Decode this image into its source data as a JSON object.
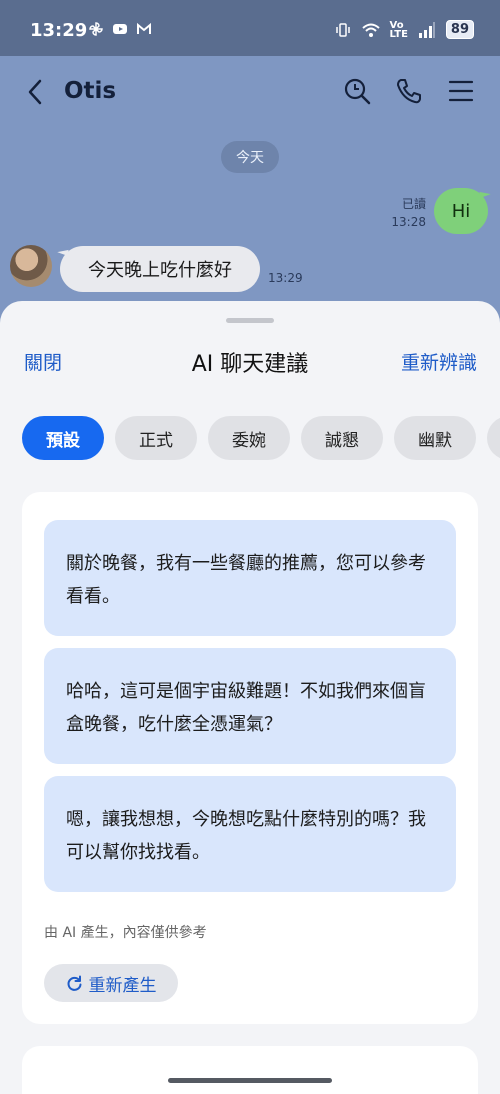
{
  "status_bar": {
    "time": "13:29",
    "volte_line1": "Vo",
    "volte_line2": "LTE",
    "battery": "89"
  },
  "chat": {
    "contact_name": "Otis",
    "date_divider": "今天",
    "my_message": {
      "text": "Hi",
      "read_label": "已讀",
      "time": "13:28"
    },
    "their_message": {
      "text": "今天晚上吃什麼好",
      "time": "13:29"
    }
  },
  "sheet": {
    "close_label": "關閉",
    "title": "AI 聊天建議",
    "reanalyze_label": "重新辨識",
    "tabs": [
      {
        "label": "預設",
        "active": true
      },
      {
        "label": "正式",
        "active": false
      },
      {
        "label": "委婉",
        "active": false
      },
      {
        "label": "誠懇",
        "active": false
      },
      {
        "label": "幽默",
        "active": false
      }
    ],
    "suggestions": [
      "關於晚餐，我有一些餐廳的推薦，您可以參考看看。",
      "哈哈，這可是個宇宙級難題！不如我們來個盲盒晚餐，吃什麼全憑運氣？",
      "嗯，讓我想想，今晚想吃點什麼特別的嗎？我可以幫你找找看。"
    ],
    "disclaimer": "由 AI 產生，內容僅供參考",
    "regenerate_label": "重新產生"
  },
  "colors": {
    "accent": "#1769f0",
    "link": "#1f5cc8",
    "chat_background": "#7f97c2",
    "my_bubble": "#7fd07a",
    "suggestion_bubble": "#d9e6fc"
  }
}
